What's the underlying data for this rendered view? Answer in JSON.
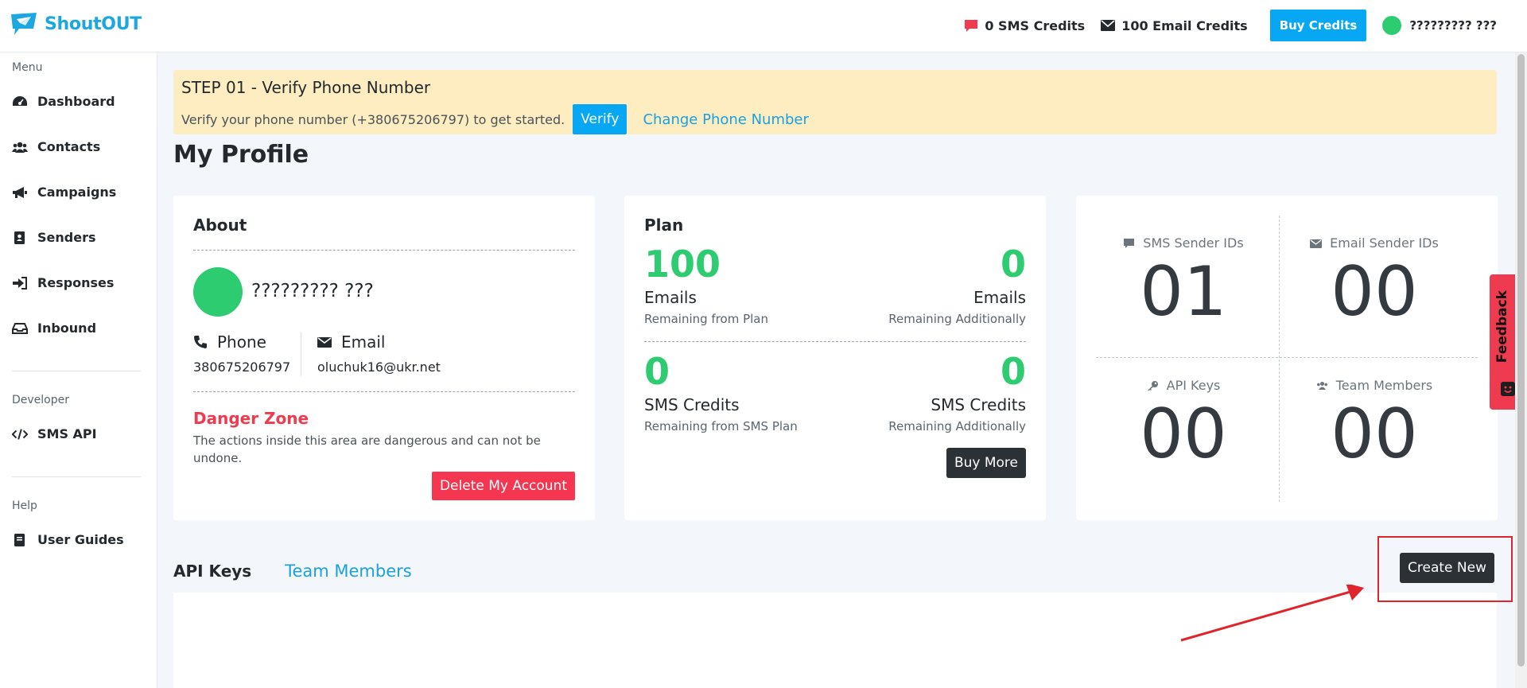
{
  "brand": {
    "name": "ShoutOUT",
    "color": "#1ba7e0"
  },
  "header": {
    "sms_credits": "0 SMS Credits",
    "email_credits": "100 Email Credits",
    "buy_credits": "Buy Credits",
    "user_name": "????????? ???"
  },
  "sidebar": {
    "sections": [
      {
        "title": "Menu",
        "items": [
          {
            "label": "Dashboard",
            "icon": "dashboard-icon"
          },
          {
            "label": "Contacts",
            "icon": "users-icon"
          },
          {
            "label": "Campaigns",
            "icon": "megaphone-icon"
          },
          {
            "label": "Senders",
            "icon": "address-book-icon"
          },
          {
            "label": "Responses",
            "icon": "sign-in-icon"
          },
          {
            "label": "Inbound",
            "icon": "inbox-icon"
          }
        ]
      },
      {
        "title": "Developer",
        "items": [
          {
            "label": "SMS API",
            "icon": "code-icon"
          }
        ]
      },
      {
        "title": "Help",
        "items": [
          {
            "label": "User Guides",
            "icon": "book-icon"
          }
        ]
      }
    ]
  },
  "alert": {
    "title": "STEP 01 - Verify Phone Number",
    "text": "Verify your phone number (+380675206797) to get started.",
    "verify_label": "Verify",
    "change_label": "Change Phone Number"
  },
  "page": {
    "title": "My Profile"
  },
  "about": {
    "title": "About",
    "name": "????????? ???",
    "phone_label": "Phone",
    "phone_value": "380675206797",
    "email_label": "Email",
    "email_value": "oluchuk16@ukr.net",
    "danger_title": "Danger Zone",
    "danger_text": "The actions inside this area are dangerous and can not be undone.",
    "delete_label": "Delete My Account"
  },
  "plan": {
    "title": "Plan",
    "rows": [
      {
        "left": {
          "value": "100",
          "unit": "Emails",
          "sub": "Remaining from Plan"
        },
        "right": {
          "value": "0",
          "unit": "Emails",
          "sub": "Remaining Additionally"
        }
      },
      {
        "left": {
          "value": "0",
          "unit": "SMS Credits",
          "sub": "Remaining from SMS Plan"
        },
        "right": {
          "value": "0",
          "unit": "SMS Credits",
          "sub": "Remaining Additionally"
        }
      }
    ],
    "buy_more": "Buy More"
  },
  "stats": [
    {
      "label": "SMS Sender IDs",
      "value": "01",
      "icon": "comment-icon"
    },
    {
      "label": "Email Sender IDs",
      "value": "00",
      "icon": "envelope-icon"
    },
    {
      "label": "API Keys",
      "value": "00",
      "icon": "key-icon"
    },
    {
      "label": "Team Members",
      "value": "00",
      "icon": "team-icon"
    }
  ],
  "tabs": {
    "api_keys": "API Keys",
    "team_members": "Team Members"
  },
  "create_new": "Create New",
  "feedback": "Feedback",
  "colors": {
    "accent": "#07a7f3",
    "success": "#2ecc71",
    "danger": "#f43651",
    "alert_bg": "#fdedc0",
    "annotation": "#e0242b"
  }
}
